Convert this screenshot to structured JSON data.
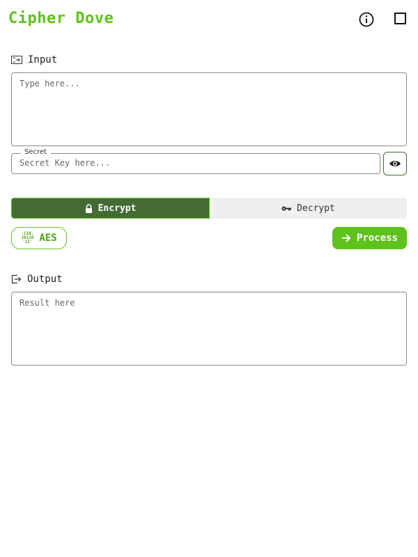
{
  "app": {
    "title": "Cipher Dove"
  },
  "input": {
    "label": "Input",
    "placeholder": "Type here..."
  },
  "secret": {
    "legend": "Secret",
    "placeholder": "Secret Key here..."
  },
  "mode": {
    "encrypt_label": "Encrypt",
    "decrypt_label": "Decrypt",
    "selected": "Encrypt"
  },
  "algorithm": {
    "label": "AES",
    "icon_lines": [
      ".110.",
      "10110",
      "'11'"
    ]
  },
  "process": {
    "label": "Process"
  },
  "output": {
    "label": "Output",
    "placeholder": "Result here"
  },
  "colors": {
    "accent": "#5ec21a",
    "active_mode_bg": "#446b34",
    "text": "#222222"
  },
  "icons": {
    "info": "info-circle-icon",
    "window": "square-icon",
    "input": "input-icon",
    "eye": "eye-icon",
    "lock": "lock-icon",
    "key": "key-icon",
    "binary": "binary-icon",
    "arrow": "arrow-right-icon",
    "output": "output-icon"
  }
}
